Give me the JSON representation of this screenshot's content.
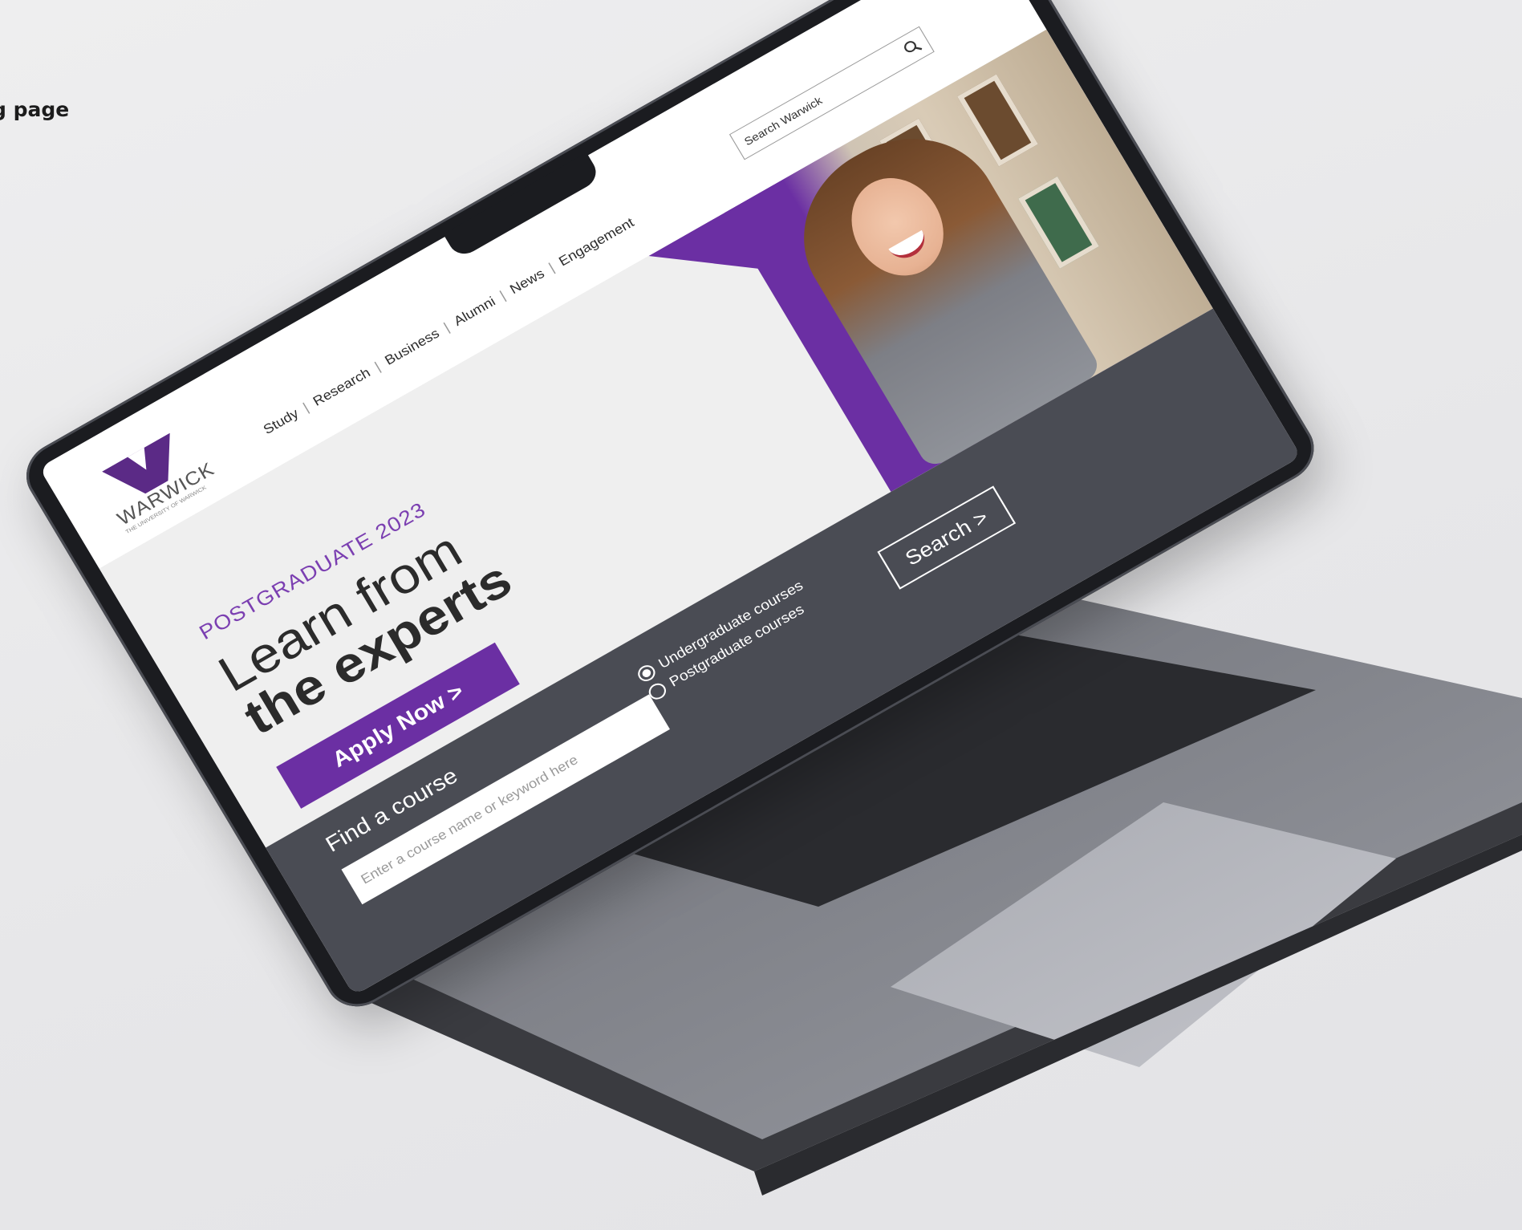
{
  "caption": {
    "text": "g page"
  },
  "header": {
    "logo": {
      "word": "WARWICK",
      "tagline": "THE UNIVERSITY OF WARWICK"
    },
    "nav": [
      "Study",
      "Research",
      "Business",
      "Alumni",
      "News",
      "Engagement"
    ],
    "search": {
      "placeholder": "Search Warwick"
    }
  },
  "hero": {
    "eyebrow": "POSTGRADUATE 2023",
    "title_light": "Learn from",
    "title_bold": "the experts",
    "cta_label": "Apply Now >"
  },
  "finder": {
    "title": "Find a course",
    "input_placeholder": "Enter a course name or keyword here",
    "options": [
      {
        "label": "Undergraduate courses",
        "selected": true
      },
      {
        "label": "Postgraduate courses",
        "selected": false
      }
    ],
    "search_label": "Search >"
  },
  "colors": {
    "brand_purple": "#6b2fa3",
    "finder_bg": "#4a4c54"
  }
}
